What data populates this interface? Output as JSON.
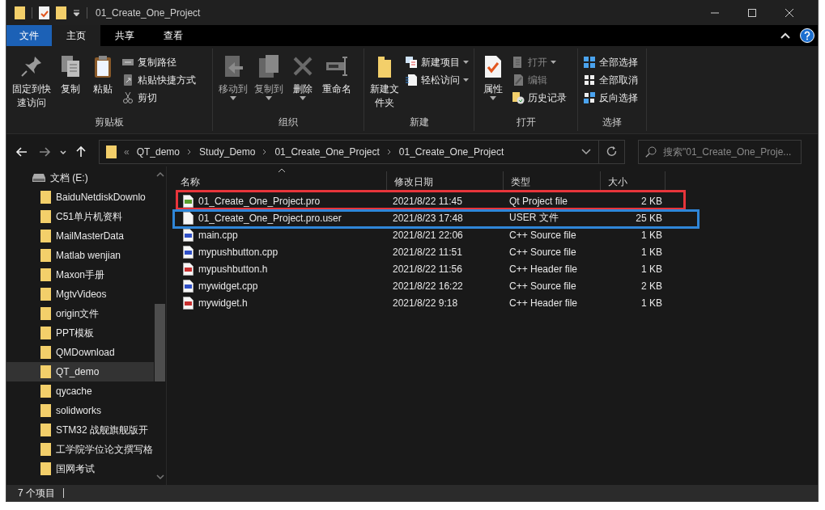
{
  "window": {
    "title": "01_Create_One_Project"
  },
  "ribbon_tabs": [
    {
      "label": "文件",
      "kind": "file",
      "selected": false
    },
    {
      "label": "主页",
      "kind": "tab",
      "selected": true
    },
    {
      "label": "共享",
      "kind": "tab",
      "selected": false
    },
    {
      "label": "查看",
      "kind": "tab",
      "selected": false
    }
  ],
  "ribbon_groups": [
    {
      "label": "剪贴板",
      "large": [
        {
          "label": "固定到快速访问",
          "disabled": false,
          "has_menu": false
        },
        {
          "label": "复制",
          "disabled": false,
          "has_menu": false
        },
        {
          "label": "粘贴",
          "disabled": false,
          "has_menu": false
        }
      ],
      "small": [
        {
          "label": "复制路径",
          "disabled": false,
          "has_menu": false
        },
        {
          "label": "粘贴快捷方式",
          "disabled": false,
          "has_menu": false
        },
        {
          "label": "剪切",
          "disabled": false,
          "has_menu": false
        }
      ]
    },
    {
      "label": "组织",
      "large": [
        {
          "label": "移动到",
          "disabled": true,
          "has_menu": true
        },
        {
          "label": "复制到",
          "disabled": true,
          "has_menu": true
        },
        {
          "label": "删除",
          "disabled": false,
          "has_menu": true
        },
        {
          "label": "重命名",
          "disabled": false,
          "has_menu": false
        }
      ]
    },
    {
      "label": "新建",
      "large": [
        {
          "label": "新建文件夹",
          "disabled": false,
          "has_menu": false
        }
      ],
      "small": [
        {
          "label": "新建项目",
          "disabled": false,
          "has_menu": true
        },
        {
          "label": "轻松访问",
          "disabled": false,
          "has_menu": true
        }
      ]
    },
    {
      "label": "打开",
      "large": [
        {
          "label": "属性",
          "disabled": false,
          "has_menu": true
        }
      ],
      "small": [
        {
          "label": "打开",
          "disabled": true,
          "has_menu": true
        },
        {
          "label": "编辑",
          "disabled": true,
          "has_menu": false
        },
        {
          "label": "历史记录",
          "disabled": false,
          "has_menu": false
        }
      ]
    },
    {
      "label": "选择",
      "small": [
        {
          "label": "全部选择",
          "disabled": false,
          "has_menu": false
        },
        {
          "label": "全部取消",
          "disabled": false,
          "has_menu": false
        },
        {
          "label": "反向选择",
          "disabled": false,
          "has_menu": false
        }
      ]
    }
  ],
  "address": {
    "overflow": "«",
    "breadcrumbs": [
      "QT_demo",
      "Study_Demo",
      "01_Create_One_Project",
      "01_Create_One_Project"
    ]
  },
  "search": {
    "placeholder": "搜索\"01_Create_One_Proje..."
  },
  "sidebar": {
    "drive": "文档 (E:)",
    "items": [
      {
        "label": "BaiduNetdiskDownlo",
        "selected": false
      },
      {
        "label": "C51单片机资料",
        "selected": false
      },
      {
        "label": "MailMasterData",
        "selected": false
      },
      {
        "label": "Matlab wenjian",
        "selected": false
      },
      {
        "label": "Maxon手册",
        "selected": false
      },
      {
        "label": "MgtvVideos",
        "selected": false
      },
      {
        "label": "origin文件",
        "selected": false
      },
      {
        "label": "PPT模板",
        "selected": false
      },
      {
        "label": "QMDownload",
        "selected": false
      },
      {
        "label": "QT_demo",
        "selected": true
      },
      {
        "label": "qycache",
        "selected": false
      },
      {
        "label": "solidworks",
        "selected": false
      },
      {
        "label": "STM32 战舰旗舰版开",
        "selected": false
      },
      {
        "label": "工学院学位论文撰写格",
        "selected": false
      },
      {
        "label": "国网考试",
        "selected": false
      }
    ]
  },
  "table": {
    "columns": [
      "名称",
      "修改日期",
      "类型",
      "大小"
    ],
    "rows": [
      {
        "name": "01_Create_One_Project.pro",
        "date": "2021/8/22 11:45",
        "type": "Qt Project file",
        "size": "2 KB",
        "kind": "pro",
        "color": "#e8353b"
      },
      {
        "name": "01_Create_One_Project.pro.user",
        "date": "2021/8/23 17:48",
        "type": "USER 文件",
        "size": "25 KB",
        "kind": "user",
        "color": "#2f86d8"
      },
      {
        "name": "main.cpp",
        "date": "2021/8/21 22:06",
        "type": "C++ Source file",
        "size": "1 KB",
        "kind": "cpp"
      },
      {
        "name": "mypushbutton.cpp",
        "date": "2021/8/22 11:51",
        "type": "C++ Source file",
        "size": "1 KB",
        "kind": "cpp"
      },
      {
        "name": "mypushbutton.h",
        "date": "2021/8/22 11:56",
        "type": "C++ Header file",
        "size": "1 KB",
        "kind": "h"
      },
      {
        "name": "mywidget.cpp",
        "date": "2021/8/22 16:22",
        "type": "C++ Source file",
        "size": "2 KB",
        "kind": "cpp"
      },
      {
        "name": "mywidget.h",
        "date": "2021/8/22 9:18",
        "type": "C++ Header file",
        "size": "1 KB",
        "kind": "h"
      }
    ]
  },
  "status_bar": {
    "count": "7 个项目"
  }
}
